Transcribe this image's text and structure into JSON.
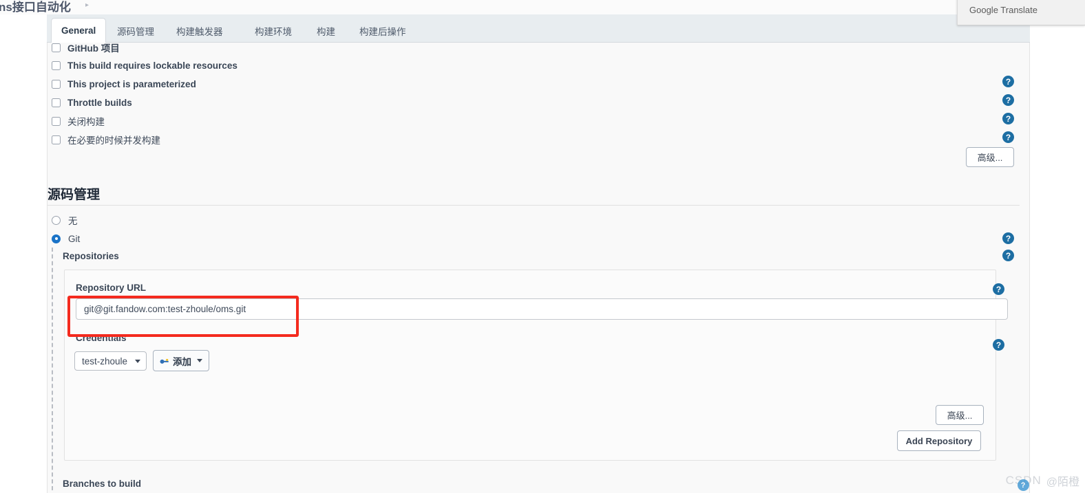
{
  "breadcrumb": {
    "text": "ns接口自动化",
    "chevron": "chevron-right-icon"
  },
  "translate_popup": {
    "label": "Google Translate"
  },
  "tabs": [
    {
      "label": "General",
      "active": true
    },
    {
      "label": "源码管理",
      "active": false
    },
    {
      "label": "构建触发器",
      "active": false
    },
    {
      "label": "构建环境",
      "active": false
    },
    {
      "label": "构建",
      "active": false
    },
    {
      "label": "构建后操作",
      "active": false
    }
  ],
  "general": {
    "checkboxes": [
      {
        "label": "GitHub 项目",
        "checked": false
      },
      {
        "label": "This build requires lockable resources",
        "checked": false
      },
      {
        "label": "This project is parameterized",
        "checked": false
      },
      {
        "label": "Throttle builds",
        "checked": false
      },
      {
        "label": "关闭构建",
        "checked": false
      },
      {
        "label": "在必要的时候并发构建",
        "checked": false
      }
    ],
    "advanced_button": "高级..."
  },
  "scm": {
    "section_title": "源码管理",
    "radios": [
      {
        "label": "无",
        "checked": false
      },
      {
        "label": "Git",
        "checked": true
      }
    ],
    "repositories_label": "Repositories",
    "repository_url_label": "Repository URL",
    "repository_url_value": "git@git.fandow.com:test-zhoule/oms.git",
    "repository_url_placeholder": "",
    "credentials_label": "Credentials",
    "credentials_selected": "test-zhoule",
    "credentials_options": [
      "test-zhoule"
    ],
    "add_credential_label": "添加",
    "add_credential_icon": "key-icon",
    "advanced_button": "高级...",
    "add_repository_button": "Add Repository",
    "branches_label": "Branches to build"
  },
  "help_icon_glyph": "?",
  "watermark": {
    "brand": "CSDN",
    "user": "@陌橙"
  },
  "colors": {
    "accent_blue": "#1d6ea3",
    "radio_blue": "#1a73c7",
    "annotation_red": "#f42a1e",
    "tabstrip_bg": "#e8edf0",
    "panel_bg": "#f9f9f9"
  }
}
